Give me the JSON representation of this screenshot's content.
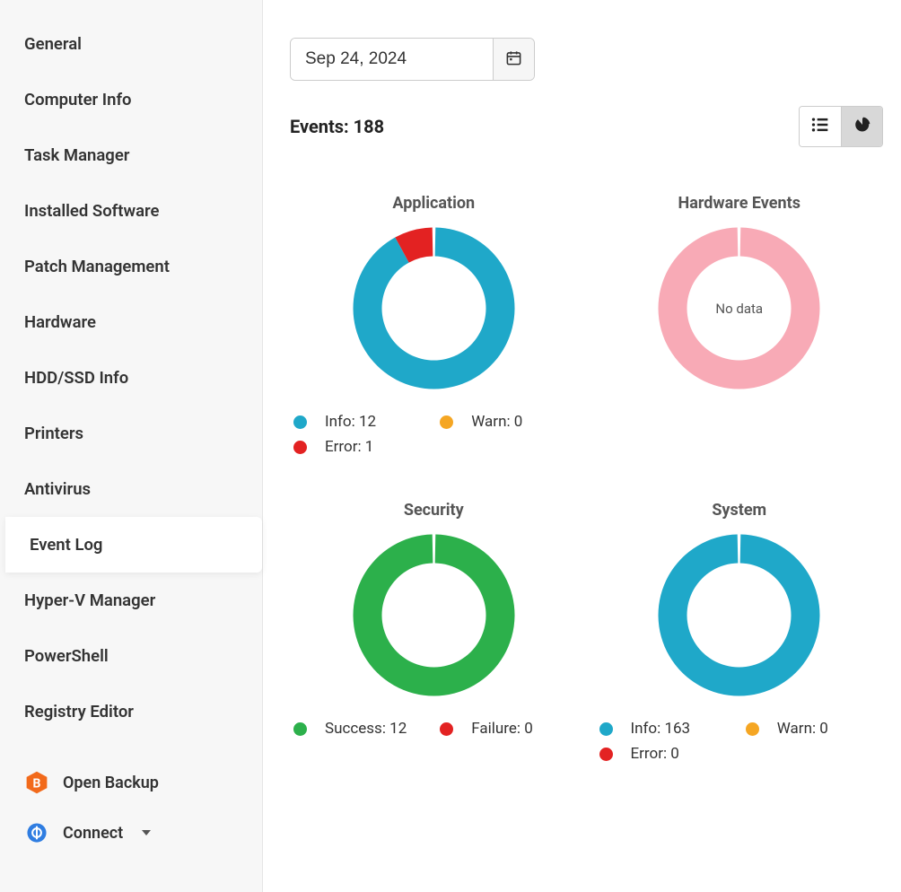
{
  "sidebar": {
    "items": [
      {
        "label": "General",
        "active": false
      },
      {
        "label": "Computer Info",
        "active": false
      },
      {
        "label": "Task Manager",
        "active": false
      },
      {
        "label": "Installed Software",
        "active": false
      },
      {
        "label": "Patch Management",
        "active": false
      },
      {
        "label": "Hardware",
        "active": false
      },
      {
        "label": "HDD/SSD Info",
        "active": false
      },
      {
        "label": "Printers",
        "active": false
      },
      {
        "label": "Antivirus",
        "active": false
      },
      {
        "label": "Event Log",
        "active": true
      },
      {
        "label": "Hyper-V Manager",
        "active": false
      },
      {
        "label": "PowerShell",
        "active": false
      },
      {
        "label": "Registry Editor",
        "active": false
      }
    ],
    "footer": {
      "open_backup": "Open Backup",
      "connect": "Connect"
    }
  },
  "header": {
    "date_value": "Sep 24, 2024",
    "events_label": "Events: 188"
  },
  "colors": {
    "info": "#1fa8c9",
    "warn": "#f5a623",
    "error": "#e32222",
    "success": "#2cb04b",
    "failure": "#e32222",
    "nodata": "#f8aab6"
  },
  "chart_data": [
    {
      "type": "pie",
      "title": "Application",
      "series": [
        {
          "name": "Info",
          "value": 12,
          "color": "#1fa8c9"
        },
        {
          "name": "Warn",
          "value": 0,
          "color": "#f5a623"
        },
        {
          "name": "Error",
          "value": 1,
          "color": "#e32222"
        }
      ],
      "no_data": false
    },
    {
      "type": "pie",
      "title": "Hardware Events",
      "series": [],
      "no_data": true,
      "no_data_label": "No data",
      "no_data_color": "#f8aab6"
    },
    {
      "type": "pie",
      "title": "Security",
      "series": [
        {
          "name": "Success",
          "value": 12,
          "color": "#2cb04b"
        },
        {
          "name": "Failure",
          "value": 0,
          "color": "#e32222"
        }
      ],
      "no_data": false
    },
    {
      "type": "pie",
      "title": "System",
      "series": [
        {
          "name": "Info",
          "value": 163,
          "color": "#1fa8c9"
        },
        {
          "name": "Warn",
          "value": 0,
          "color": "#f5a623"
        },
        {
          "name": "Error",
          "value": 0,
          "color": "#e32222"
        }
      ],
      "no_data": false
    }
  ]
}
